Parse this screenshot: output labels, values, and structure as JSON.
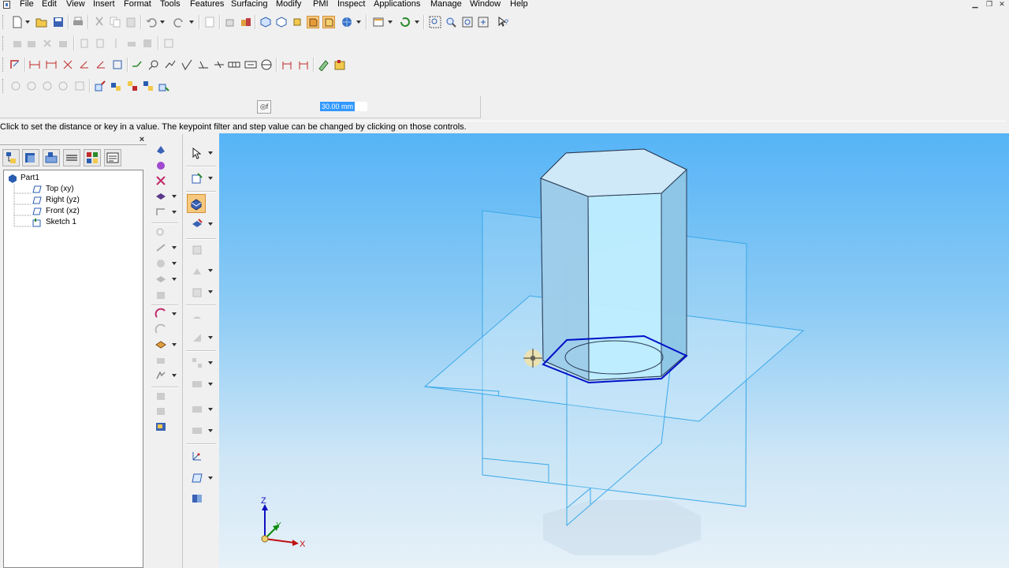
{
  "menu": {
    "items": [
      "File",
      "Edit",
      "View",
      "Insert",
      "Format",
      "Tools",
      "Features",
      "Surfacing",
      "Modify",
      "PMI",
      "Inspect",
      "Applications",
      "Manage",
      "Window",
      "Help"
    ]
  },
  "value_bar": {
    "distance_value": "30.00 mm"
  },
  "prompt": {
    "text": "Click to set the distance or key in a value. The keypoint filter and step value can be changed by clicking on those controls."
  },
  "pathfinder": {
    "close_glyph": "×",
    "tree": [
      {
        "label": "Part1",
        "icon": "part-icon"
      },
      {
        "label": "Top (xy)",
        "icon": "plane-icon"
      },
      {
        "label": "Right (yz)",
        "icon": "plane-icon"
      },
      {
        "label": "Front (xz)",
        "icon": "plane-icon"
      },
      {
        "label": "Sketch 1",
        "icon": "sketch-icon"
      }
    ]
  },
  "triad": {
    "z_label": "Z",
    "y_label": "Y",
    "x_label": "X"
  },
  "colors": {
    "accent_highlight": "#f7c97d",
    "sketch_profile": "#0010c8",
    "plane_edge": "#3aa8e8",
    "solid_edge": "#2a3a55"
  }
}
